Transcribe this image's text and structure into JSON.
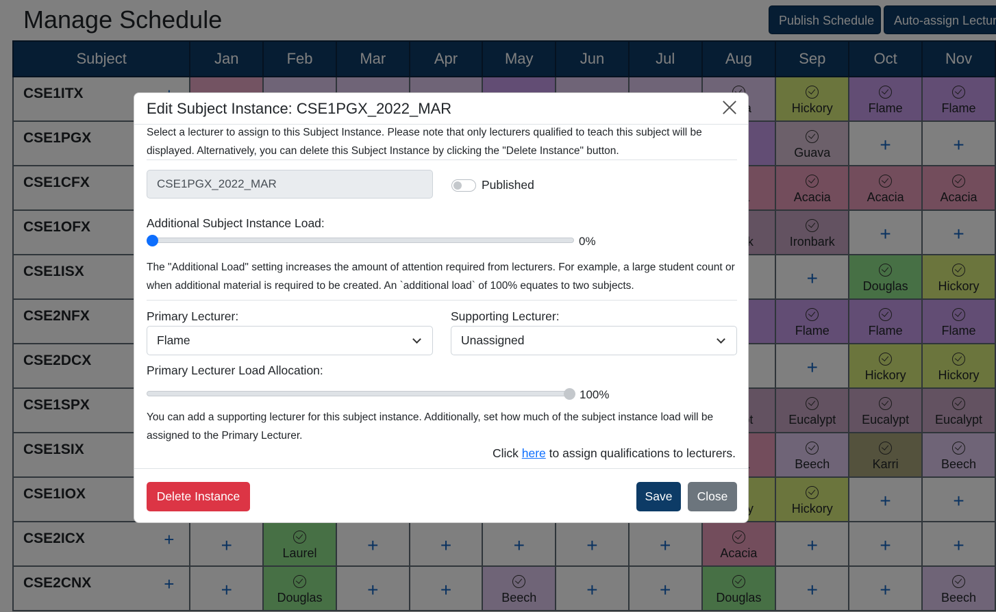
{
  "page": {
    "title": "Manage Schedule",
    "publish_button": "Publish Schedule",
    "auto_assign_button": "Auto-assign Lecturers"
  },
  "table": {
    "subject_header": "Subject",
    "months": [
      "Jan",
      "Feb",
      "Mar",
      "Apr",
      "May",
      "Jun",
      "Jul",
      "Aug",
      "Sep",
      "Oct",
      "Nov"
    ],
    "rows": [
      {
        "subject": "CSE1ITX",
        "cells": [
          {
            "t": "check",
            "c": "c-pink"
          },
          {
            "t": "check",
            "c": "c-lilac"
          },
          {
            "t": "check",
            "c": "c-lilac"
          },
          {
            "t": "check",
            "c": "c-lilac"
          },
          {
            "t": "check",
            "c": "c-purple"
          },
          {
            "t": "check",
            "c": "c-lilac"
          },
          {
            "t": "check",
            "c": "c-lilac"
          },
          {
            "t": "check",
            "c": "c-lilac",
            "n": "…va"
          },
          {
            "t": "check",
            "c": "c-olive",
            "n": "Hickory"
          },
          {
            "t": "check",
            "c": "c-purple",
            "n": "Flame"
          },
          {
            "t": "check",
            "c": "c-purple",
            "n": "Flame"
          }
        ]
      },
      {
        "subject": "CSE1PGX",
        "cells": [
          {
            "t": "plus"
          },
          {
            "t": "plus"
          },
          {
            "t": "plus"
          },
          {
            "t": "plus"
          },
          {
            "t": "plus"
          },
          {
            "t": "plus"
          },
          {
            "t": "plus"
          },
          {
            "t": "check",
            "c": "c-purple",
            "n": "…e"
          },
          {
            "t": "check",
            "c": "c-mauve",
            "n": "Guava"
          },
          {
            "t": "plus"
          },
          {
            "t": "plus"
          }
        ]
      },
      {
        "subject": "CSE1CFX",
        "cells": [
          {
            "t": "plus"
          },
          {
            "t": "plus"
          },
          {
            "t": "plus"
          },
          {
            "t": "plus"
          },
          {
            "t": "plus"
          },
          {
            "t": "plus"
          },
          {
            "t": "plus"
          },
          {
            "t": "check",
            "c": "c-rose",
            "n": "…ia"
          },
          {
            "t": "check",
            "c": "c-rose",
            "n": "Acacia"
          },
          {
            "t": "check",
            "c": "c-rose",
            "n": "Acacia"
          },
          {
            "t": "check",
            "c": "c-rose",
            "n": "Acacia"
          }
        ]
      },
      {
        "subject": "CSE1OFX",
        "cells": [
          {
            "t": "plus"
          },
          {
            "t": "plus"
          },
          {
            "t": "plus"
          },
          {
            "t": "plus"
          },
          {
            "t": "plus"
          },
          {
            "t": "plus"
          },
          {
            "t": "plus"
          },
          {
            "t": "check",
            "c": "c-plum",
            "n": "…ark"
          },
          {
            "t": "check",
            "c": "c-plum",
            "n": "Ironbark"
          },
          {
            "t": "plus"
          },
          {
            "t": "plus"
          }
        ]
      },
      {
        "subject": "CSE1ISX",
        "cells": [
          {
            "t": "plus"
          },
          {
            "t": "plus"
          },
          {
            "t": "plus"
          },
          {
            "t": "plus"
          },
          {
            "t": "plus"
          },
          {
            "t": "plus"
          },
          {
            "t": "plus"
          },
          {
            "t": "plus"
          },
          {
            "t": "plus"
          },
          {
            "t": "check",
            "c": "c-green",
            "n": "Douglas"
          },
          {
            "t": "check",
            "c": "c-olive",
            "n": "Hickory"
          }
        ]
      },
      {
        "subject": "CSE2NFX",
        "cells": [
          {
            "t": "plus"
          },
          {
            "t": "plus"
          },
          {
            "t": "plus"
          },
          {
            "t": "plus"
          },
          {
            "t": "plus"
          },
          {
            "t": "plus"
          },
          {
            "t": "plus"
          },
          {
            "t": "check",
            "c": "c-purple",
            "n": "…e"
          },
          {
            "t": "check",
            "c": "c-purple",
            "n": "Flame"
          },
          {
            "t": "check",
            "c": "c-purple",
            "n": "Flame"
          },
          {
            "t": "check",
            "c": "c-purple",
            "n": "Flame"
          }
        ]
      },
      {
        "subject": "CSE2DCX",
        "cells": [
          {
            "t": "plus"
          },
          {
            "t": "plus"
          },
          {
            "t": "plus"
          },
          {
            "t": "plus"
          },
          {
            "t": "plus"
          },
          {
            "t": "plus"
          },
          {
            "t": "plus"
          },
          {
            "t": "plus"
          },
          {
            "t": "plus"
          },
          {
            "t": "check",
            "c": "c-olive",
            "n": "Hickory"
          },
          {
            "t": "check",
            "c": "c-olive",
            "n": "Hickory"
          }
        ]
      },
      {
        "subject": "CSE1SPX",
        "cells": [
          {
            "t": "plus"
          },
          {
            "t": "plus"
          },
          {
            "t": "plus"
          },
          {
            "t": "plus"
          },
          {
            "t": "plus"
          },
          {
            "t": "plus"
          },
          {
            "t": "plus"
          },
          {
            "t": "check",
            "c": "c-plum",
            "n": "…ypt"
          },
          {
            "t": "check",
            "c": "c-plum",
            "n": "Eucalypt"
          },
          {
            "t": "check",
            "c": "c-plum",
            "n": "Eucalypt"
          },
          {
            "t": "check",
            "c": "c-plum",
            "n": "Eucalypt"
          }
        ]
      },
      {
        "subject": "CSE1SIX",
        "cells": [
          {
            "t": "plus"
          },
          {
            "t": "plus"
          },
          {
            "t": "plus"
          },
          {
            "t": "plus"
          },
          {
            "t": "plus"
          },
          {
            "t": "plus"
          },
          {
            "t": "plus"
          },
          {
            "t": "check",
            "c": "c-rose",
            "n": "…ia"
          },
          {
            "t": "check",
            "c": "c-lilac",
            "n": "Beech"
          },
          {
            "t": "check",
            "c": "c-khaki",
            "n": "Karri"
          },
          {
            "t": "check",
            "c": "c-lilac",
            "n": "Beech"
          }
        ]
      },
      {
        "subject": "CSE1IOX",
        "cells": [
          {
            "t": "plus"
          },
          {
            "t": "plus"
          },
          {
            "t": "plus"
          },
          {
            "t": "plus"
          },
          {
            "t": "plus"
          },
          {
            "t": "plus"
          },
          {
            "t": "plus"
          },
          {
            "t": "check",
            "c": "c-olive",
            "n": "…ory"
          },
          {
            "t": "check",
            "c": "c-olive",
            "n": "Hickory"
          },
          {
            "t": "plus"
          },
          {
            "t": "plus"
          }
        ]
      },
      {
        "subject": "CSE2ICX",
        "cells": [
          {
            "t": "plus"
          },
          {
            "t": "check",
            "c": "c-green",
            "n": "Laurel"
          },
          {
            "t": "plus"
          },
          {
            "t": "plus"
          },
          {
            "t": "plus"
          },
          {
            "t": "plus"
          },
          {
            "t": "plus"
          },
          {
            "t": "check",
            "c": "c-rose",
            "n": "Acacia"
          },
          {
            "t": "plus"
          },
          {
            "t": "plus"
          },
          {
            "t": "plus"
          }
        ]
      },
      {
        "subject": "CSE2CNX",
        "cells": [
          {
            "t": "plus"
          },
          {
            "t": "check",
            "c": "c-green",
            "n": "Douglas"
          },
          {
            "t": "plus"
          },
          {
            "t": "plus"
          },
          {
            "t": "check",
            "c": "c-lilac",
            "n": "Beech"
          },
          {
            "t": "plus"
          },
          {
            "t": "plus"
          },
          {
            "t": "check",
            "c": "c-green",
            "n": "Douglas"
          },
          {
            "t": "plus"
          },
          {
            "t": "plus"
          },
          {
            "t": "check",
            "c": "c-lilac",
            "n": "Beech"
          }
        ]
      }
    ]
  },
  "modal": {
    "title": "Edit Subject Instance: CSE1PGX_2022_MAR",
    "intro": "Select a lecturer to assign to this Subject Instance. Please note that only lecturers qualified to teach this subject will be displayed. Alternatively, you can delete this Subject Instance by clicking the \"Delete Instance\" button.",
    "instance_id": "CSE1PGX_2022_MAR",
    "published_label": "Published",
    "published": false,
    "additional_load_label": "Additional Subject Instance Load:",
    "additional_load_value": 0,
    "additional_load_pct": "0%",
    "additional_load_help": "The \"Additional Load\" setting increases the amount of attention required from lecturers. For example, a large student count or when additional material is required to be created. An `additional load` of 100% equates to two subjects.",
    "primary_lecturer_label": "Primary Lecturer:",
    "primary_lecturer_value": "Flame",
    "supporting_lecturer_label": "Supporting Lecturer:",
    "supporting_lecturer_value": "Unassigned",
    "primary_load_label": "Primary Lecturer Load Allocation:",
    "primary_load_value": 100,
    "primary_load_pct": "100%",
    "supporting_help": "You can add a supporting lecturer for this subject instance. Additionally, set how much of the subject instance load will be assigned to the Primary Lecturer.",
    "qual_prefix": "Click ",
    "qual_link": "here",
    "qual_suffix": " to assign qualifications to lecturers.",
    "delete_button": "Delete Instance",
    "save_button": "Save",
    "close_button": "Close"
  },
  "colors": {
    "navy": "#0d3b66",
    "danger": "#dc3545",
    "secondary": "#6c757d",
    "slider_thumb": "#0d6efd"
  }
}
